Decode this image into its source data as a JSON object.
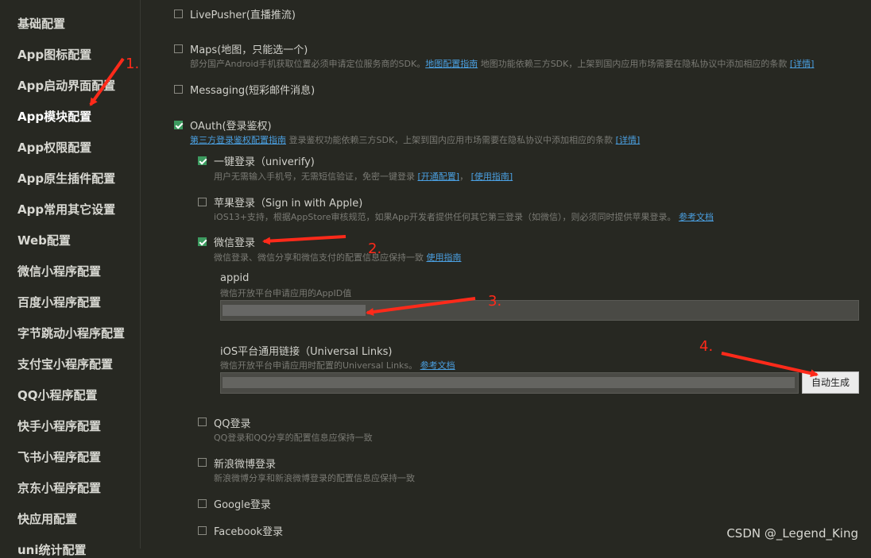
{
  "sidebar": {
    "items": [
      {
        "label": "基础配置"
      },
      {
        "label": "App图标配置"
      },
      {
        "label": "App启动界面配置"
      },
      {
        "label": "App模块配置"
      },
      {
        "label": "App权限配置"
      },
      {
        "label": "App原生插件配置"
      },
      {
        "label": "App常用其它设置"
      },
      {
        "label": "Web配置"
      },
      {
        "label": "微信小程序配置"
      },
      {
        "label": "百度小程序配置"
      },
      {
        "label": "字节跳动小程序配置"
      },
      {
        "label": "支付宝小程序配置"
      },
      {
        "label": "QQ小程序配置"
      },
      {
        "label": "快手小程序配置"
      },
      {
        "label": "飞书小程序配置"
      },
      {
        "label": "京东小程序配置"
      },
      {
        "label": "快应用配置"
      },
      {
        "label": "uni统计配置"
      }
    ],
    "active_index": 3
  },
  "modules": {
    "livepusher": {
      "label": "LivePusher(直播推流)",
      "checked": false
    },
    "maps": {
      "label": "Maps(地图，只能选一个)",
      "checked": false,
      "desc_prefix": "部分国产Android手机获取位置必须申请定位服务商的SDK。",
      "desc_link1": "地图配置指南",
      "desc_middle": " 地图功能依赖三方SDK，上架到国内应用市场需要在隐私协议中添加相应的条款 ",
      "desc_link2": "[详情]"
    },
    "messaging": {
      "label": "Messaging(短彩邮件消息)",
      "checked": false
    },
    "oauth": {
      "label": "OAuth(登录鉴权)",
      "checked": true,
      "desc_link1": "第三方登录鉴权配置指南",
      "desc_middle": " 登录鉴权功能依赖三方SDK，上架到国内应用市场需要在隐私协议中添加相应的条款 ",
      "desc_link2": "[详情]"
    }
  },
  "oauth_items": {
    "univerify": {
      "label": "一键登录（univerify)",
      "checked": true,
      "desc": "用户无需输入手机号，无需短信验证，免密一键登录 ",
      "link1": "[开通配置]",
      "sep": "，",
      "link2": "[使用指南]"
    },
    "apple": {
      "label": "苹果登录（Sign in with Apple)",
      "checked": false,
      "desc": "iOS13+支持，根据AppStore审核规范，如果App开发者提供任何其它第三登录（如微信），则必须同时提供苹果登录。",
      "link": "参考文档"
    },
    "weixin": {
      "label": "微信登录",
      "checked": true,
      "desc": "微信登录、微信分享和微信支付的配置信息应保持一致 ",
      "link": "使用指南",
      "appid_label": "appid",
      "appid_hint": "微信开放平台申请应用的AppID值",
      "ul_label": "iOS平台通用链接（Universal Links)",
      "ul_hint": "微信开放平台申请应用时配置的Universal Links。",
      "ul_link": "参考文档",
      "generate_button": "自动生成"
    },
    "qq": {
      "label": "QQ登录",
      "checked": false,
      "desc": "QQ登录和QQ分享的配置信息应保持一致"
    },
    "sina": {
      "label": "新浪微博登录",
      "checked": false,
      "desc": "新浪微博分享和新浪微博登录的配置信息应保持一致"
    },
    "google": {
      "label": "Google登录",
      "checked": false
    },
    "facebook": {
      "label": "Facebook登录",
      "checked": false
    }
  },
  "annotations": {
    "a1": "1.",
    "a2": "2.",
    "a3": "3.",
    "a4": "4."
  },
  "watermark": "CSDN @_Legend_King",
  "colors": {
    "background": "#272822",
    "check_green": "#3c9a5f",
    "link": "#4a9fe0",
    "annotation": "#ff2a1a"
  }
}
